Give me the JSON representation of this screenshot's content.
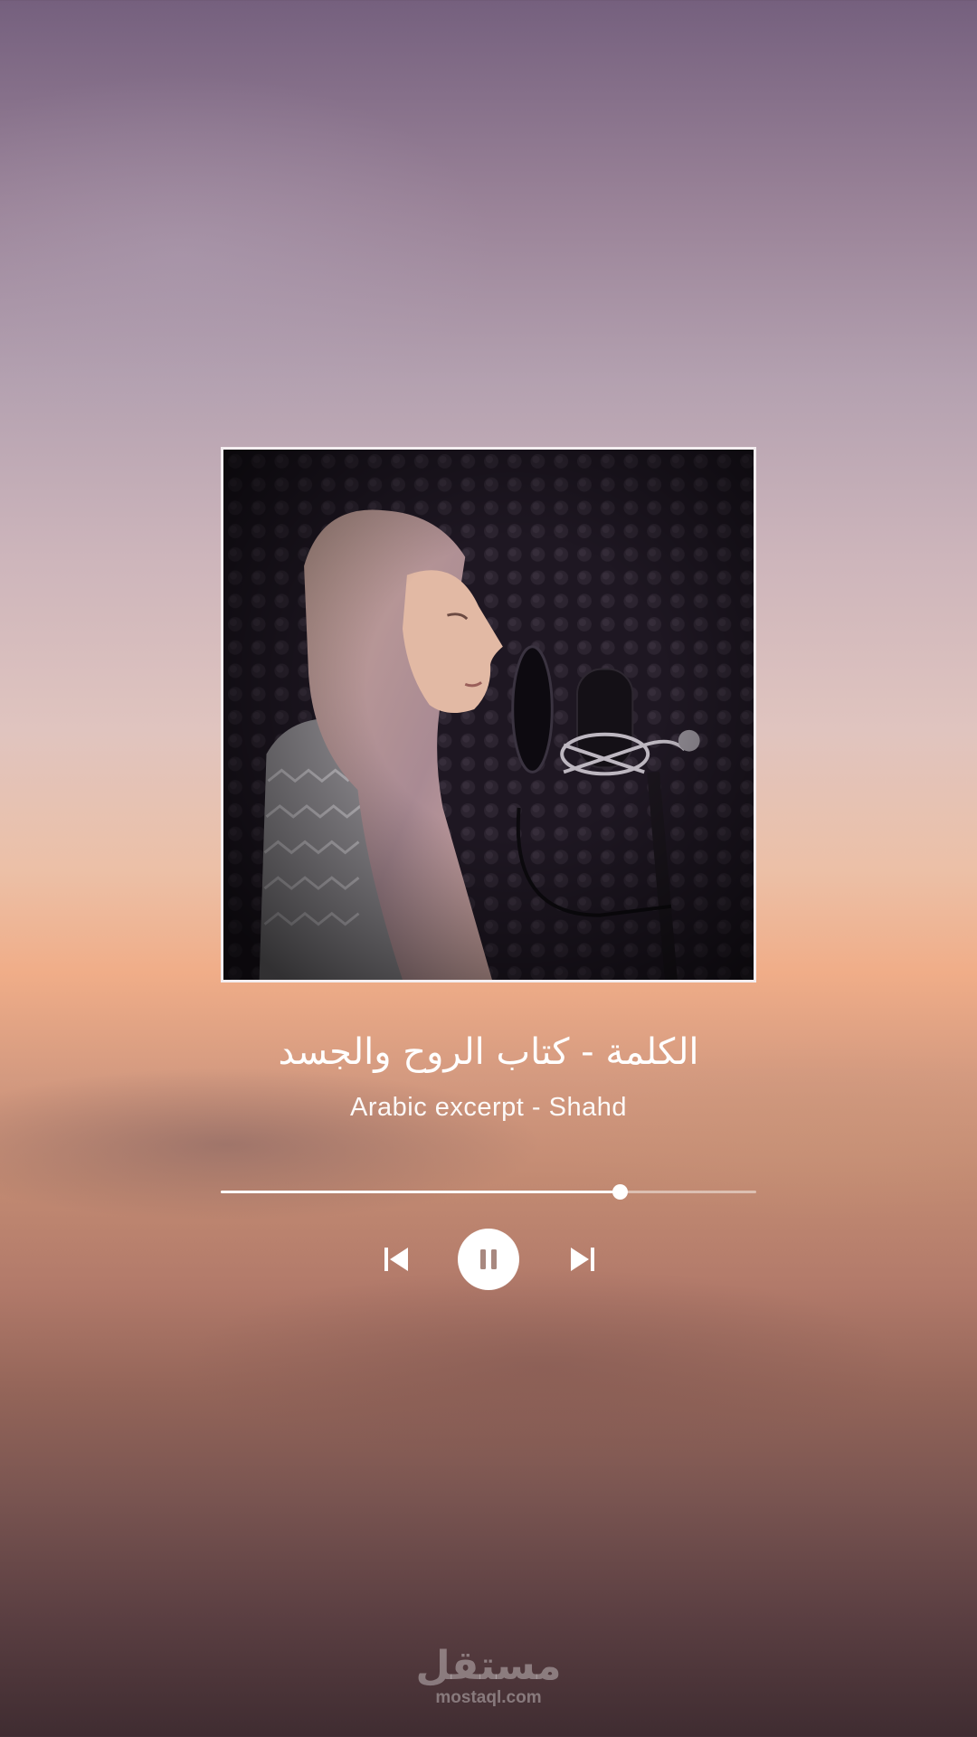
{
  "track": {
    "title": "الكلمة - كتاب الروح والجسد",
    "subtitle": "Arabic excerpt - Shahd"
  },
  "cover_art": {
    "description_icon": "singer-recording-photo"
  },
  "playback": {
    "progress": 0.745,
    "state": "playing"
  },
  "controls": {
    "previous_icon": "skip-previous-icon",
    "pause_icon": "pause-icon",
    "next_icon": "skip-next-icon"
  },
  "watermark": {
    "arabic": "مستقل",
    "latin": "mostaql.com"
  },
  "colors": {
    "accent": "#ffffff",
    "track_rest": "#e6d2c8"
  }
}
